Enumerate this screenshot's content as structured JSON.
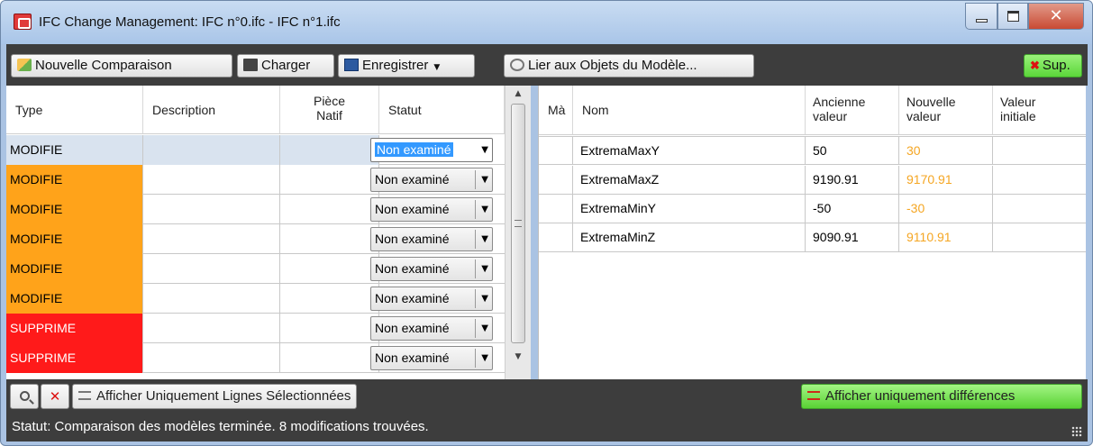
{
  "window": {
    "title": "IFC Change Management: IFC n°0.ifc - IFC n°1.ifc",
    "buttons": [
      "minimize",
      "maximize",
      "close"
    ]
  },
  "toolbar": {
    "new_comparison": "Nouvelle Comparaison",
    "load": "Charger",
    "save": "Enregistrer",
    "link_objects": "Lier aux Objets du Modèle...",
    "delete": "Sup."
  },
  "left_grid": {
    "columns": [
      "Type",
      "Description",
      "Pièce Natif",
      "Statut"
    ],
    "column_lines": {
      "piece_line1": "Pièce",
      "piece_line2": "Natif"
    },
    "rows": [
      {
        "type": "MODIFIE",
        "description": "",
        "piece": "",
        "status": "Non examiné",
        "kind": "selected"
      },
      {
        "type": "MODIFIE",
        "description": "",
        "piece": "",
        "status": "Non examiné",
        "kind": "modified"
      },
      {
        "type": "MODIFIE",
        "description": "",
        "piece": "",
        "status": "Non examiné",
        "kind": "modified"
      },
      {
        "type": "MODIFIE",
        "description": "",
        "piece": "",
        "status": "Non examiné",
        "kind": "modified"
      },
      {
        "type": "MODIFIE",
        "description": "",
        "piece": "",
        "status": "Non examiné",
        "kind": "modified"
      },
      {
        "type": "MODIFIE",
        "description": "",
        "piece": "",
        "status": "Non examiné",
        "kind": "modified"
      },
      {
        "type": "SUPPRIME",
        "description": "",
        "piece": "",
        "status": "Non examiné",
        "kind": "deleted"
      },
      {
        "type": "SUPPRIME",
        "description": "",
        "piece": "",
        "status": "Non examiné",
        "kind": "deleted"
      }
    ]
  },
  "right_grid": {
    "columns": [
      "Mà",
      "Nom",
      "Ancienne valeur",
      "Nouvelle valeur",
      "Valeur initiale"
    ],
    "column_lines": {
      "old_l1": "Ancienne",
      "old_l2": "valeur",
      "new_l1": "Nouvelle",
      "new_l2": "valeur",
      "init_l1": "Valeur",
      "init_l2": "initiale"
    },
    "rows": [
      {
        "name": "ExtremaMaxY",
        "old": "50",
        "new": "30",
        "initial": ""
      },
      {
        "name": "ExtremaMaxZ",
        "old": "9190.91",
        "new": "9170.91",
        "initial": ""
      },
      {
        "name": "ExtremaMinY",
        "old": "-50",
        "new": "-30",
        "initial": ""
      },
      {
        "name": "ExtremaMinZ",
        "old": "9090.91",
        "new": "9110.91",
        "initial": ""
      }
    ]
  },
  "bottombar": {
    "only_selected": "Afficher Uniquement Lignes Sélectionnées",
    "only_differences": "Afficher uniquement différences"
  },
  "statusbar": {
    "text": "Statut:  Comparaison des modèles terminée. 8 modifications trouvées."
  },
  "colors": {
    "modified": "#ffa31a",
    "deleted": "#ff1a1a",
    "selected": "#d9e3ef",
    "new_value_text": "#f5a623",
    "green_button": "#59d234",
    "dark_bar": "#3d3d3d"
  }
}
